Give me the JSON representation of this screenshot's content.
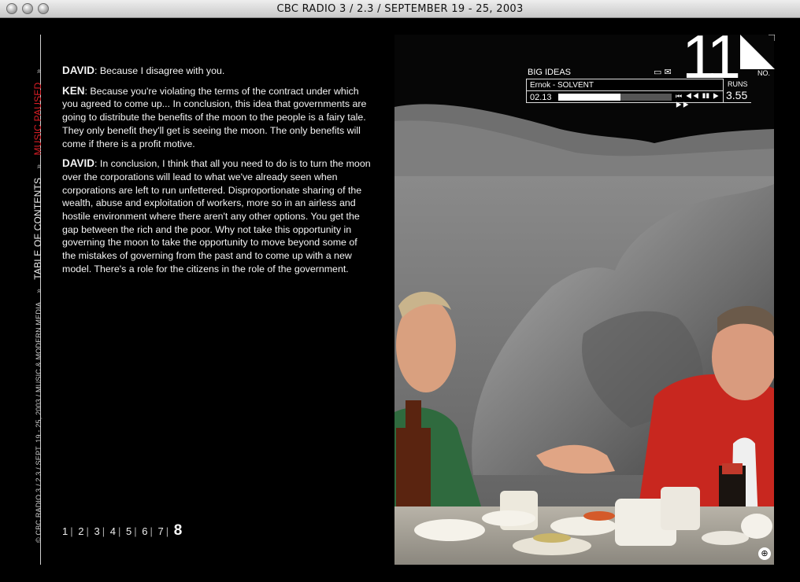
{
  "window": {
    "title": "CBC RADIO 3 / 2.3 / SEPTEMBER 19 - 25, 2003"
  },
  "sidebar": {
    "copyright": "© CBC RADIO 3 / 2.3 / SEPT. 19 - 25, 2003 / MUSIC & MODERN MEDIA",
    "separator": "»",
    "table_of_contents": "TABLE OF CONTENTS",
    "music_status": "MUSIC PAUSED",
    "music_status_color": "#d81e26"
  },
  "transcript": [
    {
      "speaker": "DAVID",
      "text": ": Because I disagree with you."
    },
    {
      "speaker": "KEN",
      "text": ": Because you're violating the terms of the contract under which you agreed to come up... In conclusion, this idea that governments are going to distribute the benefits of the moon to the people is a fairy tale. They only benefit they'll get is seeing the moon. The only benefits will come if there is a profit motive."
    },
    {
      "speaker": "DAVID",
      "text": ": In conclusion, I think that all you need to do is to turn the moon over the corporations will lead to what we've already seen when corporations are left to run unfettered. Disproportionate sharing of the wealth, abuse and exploitation of workers, more so in an airless and hostile environment where there aren't any other options. You get the gap between the rich and the poor. Why not take this opportunity in governing the moon to take the opportunity to move beyond some of the mistakes of governing from the past and to come up with a new model. There's a role for the citizens in the role of the government."
    }
  ],
  "pagination": {
    "pages": [
      "1",
      "2",
      "3",
      "4",
      "5",
      "6",
      "7"
    ],
    "current": "8",
    "separator": "|"
  },
  "player": {
    "issue_number": "11",
    "no_label": "NO.",
    "section": "BIG IDEAS",
    "track": "Ernok - SOLVENT",
    "time": "02.13",
    "progress": 0.55,
    "runs_label": "RUNS",
    "runs_value": "3.55",
    "controls": "⏮ ◀◀ ❚❚ ▶ ▶▶"
  }
}
